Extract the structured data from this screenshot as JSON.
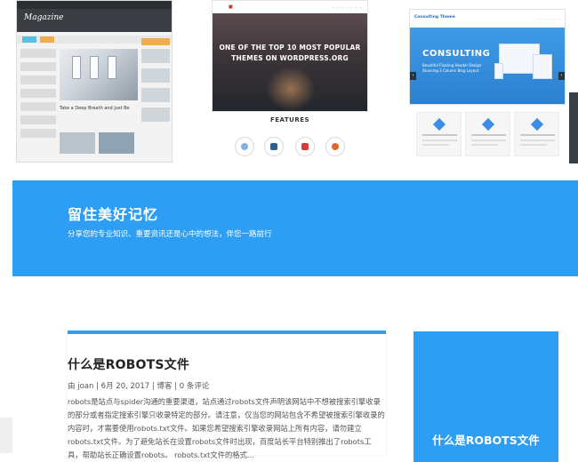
{
  "showcase": {
    "shot1": {
      "logo": "Magazine",
      "post_title": "Take a Deep Breath and Just Be"
    },
    "shot2": {
      "headline_line1": "ONE OF THE TOP 10 MOST POPULAR",
      "headline_line2": "THEMES ON WORDPRESS.ORG",
      "features_label": "FEATURES",
      "feature_icons": [
        "arrows-icon",
        "screen-icon",
        "red-app-icon",
        "fire-icon"
      ]
    },
    "shot3": {
      "logo": "Consulting Theme",
      "hero_title": "CONSULTING",
      "hero_sub_line1": "Beautiful Floating Header Design",
      "hero_sub_line2": "Stunning 3 Column Blog Layout"
    }
  },
  "banner": {
    "title": "留住美好记忆",
    "subtitle": "分享您的专业知识、重要资讯还是心中的想法，伴您一路前行"
  },
  "post": {
    "title": "什么是ROBOTS文件",
    "meta": {
      "by": "由",
      "author": "joan",
      "sep1": " | ",
      "date": "6月 20, 2017",
      "sep2": " | ",
      "category": "博客",
      "sep3": " | ",
      "comments": "0 条评论"
    },
    "excerpt": "robots是站点与spider沟通的重要渠道，站点通过robots文件声明该网站中不想被搜索引擎收录的部分或者指定搜索引擎只收录特定的部分。请注意，仅当您的网站包含不希望被搜索引擎收录的内容时，才需要使用robots.txt文件。如果您希望搜索引擎收录网站上所有内容，请勿建立robots.txt文件。为了避免站长在设置robots文件时出现，百度站长平台特别推出了robots工具，帮助站长正确设置robots。 robots.txt文件的格式..."
  },
  "widget": {
    "title": "什么是ROBOTS文件"
  },
  "colors": {
    "accent": "#2d9ef3"
  }
}
